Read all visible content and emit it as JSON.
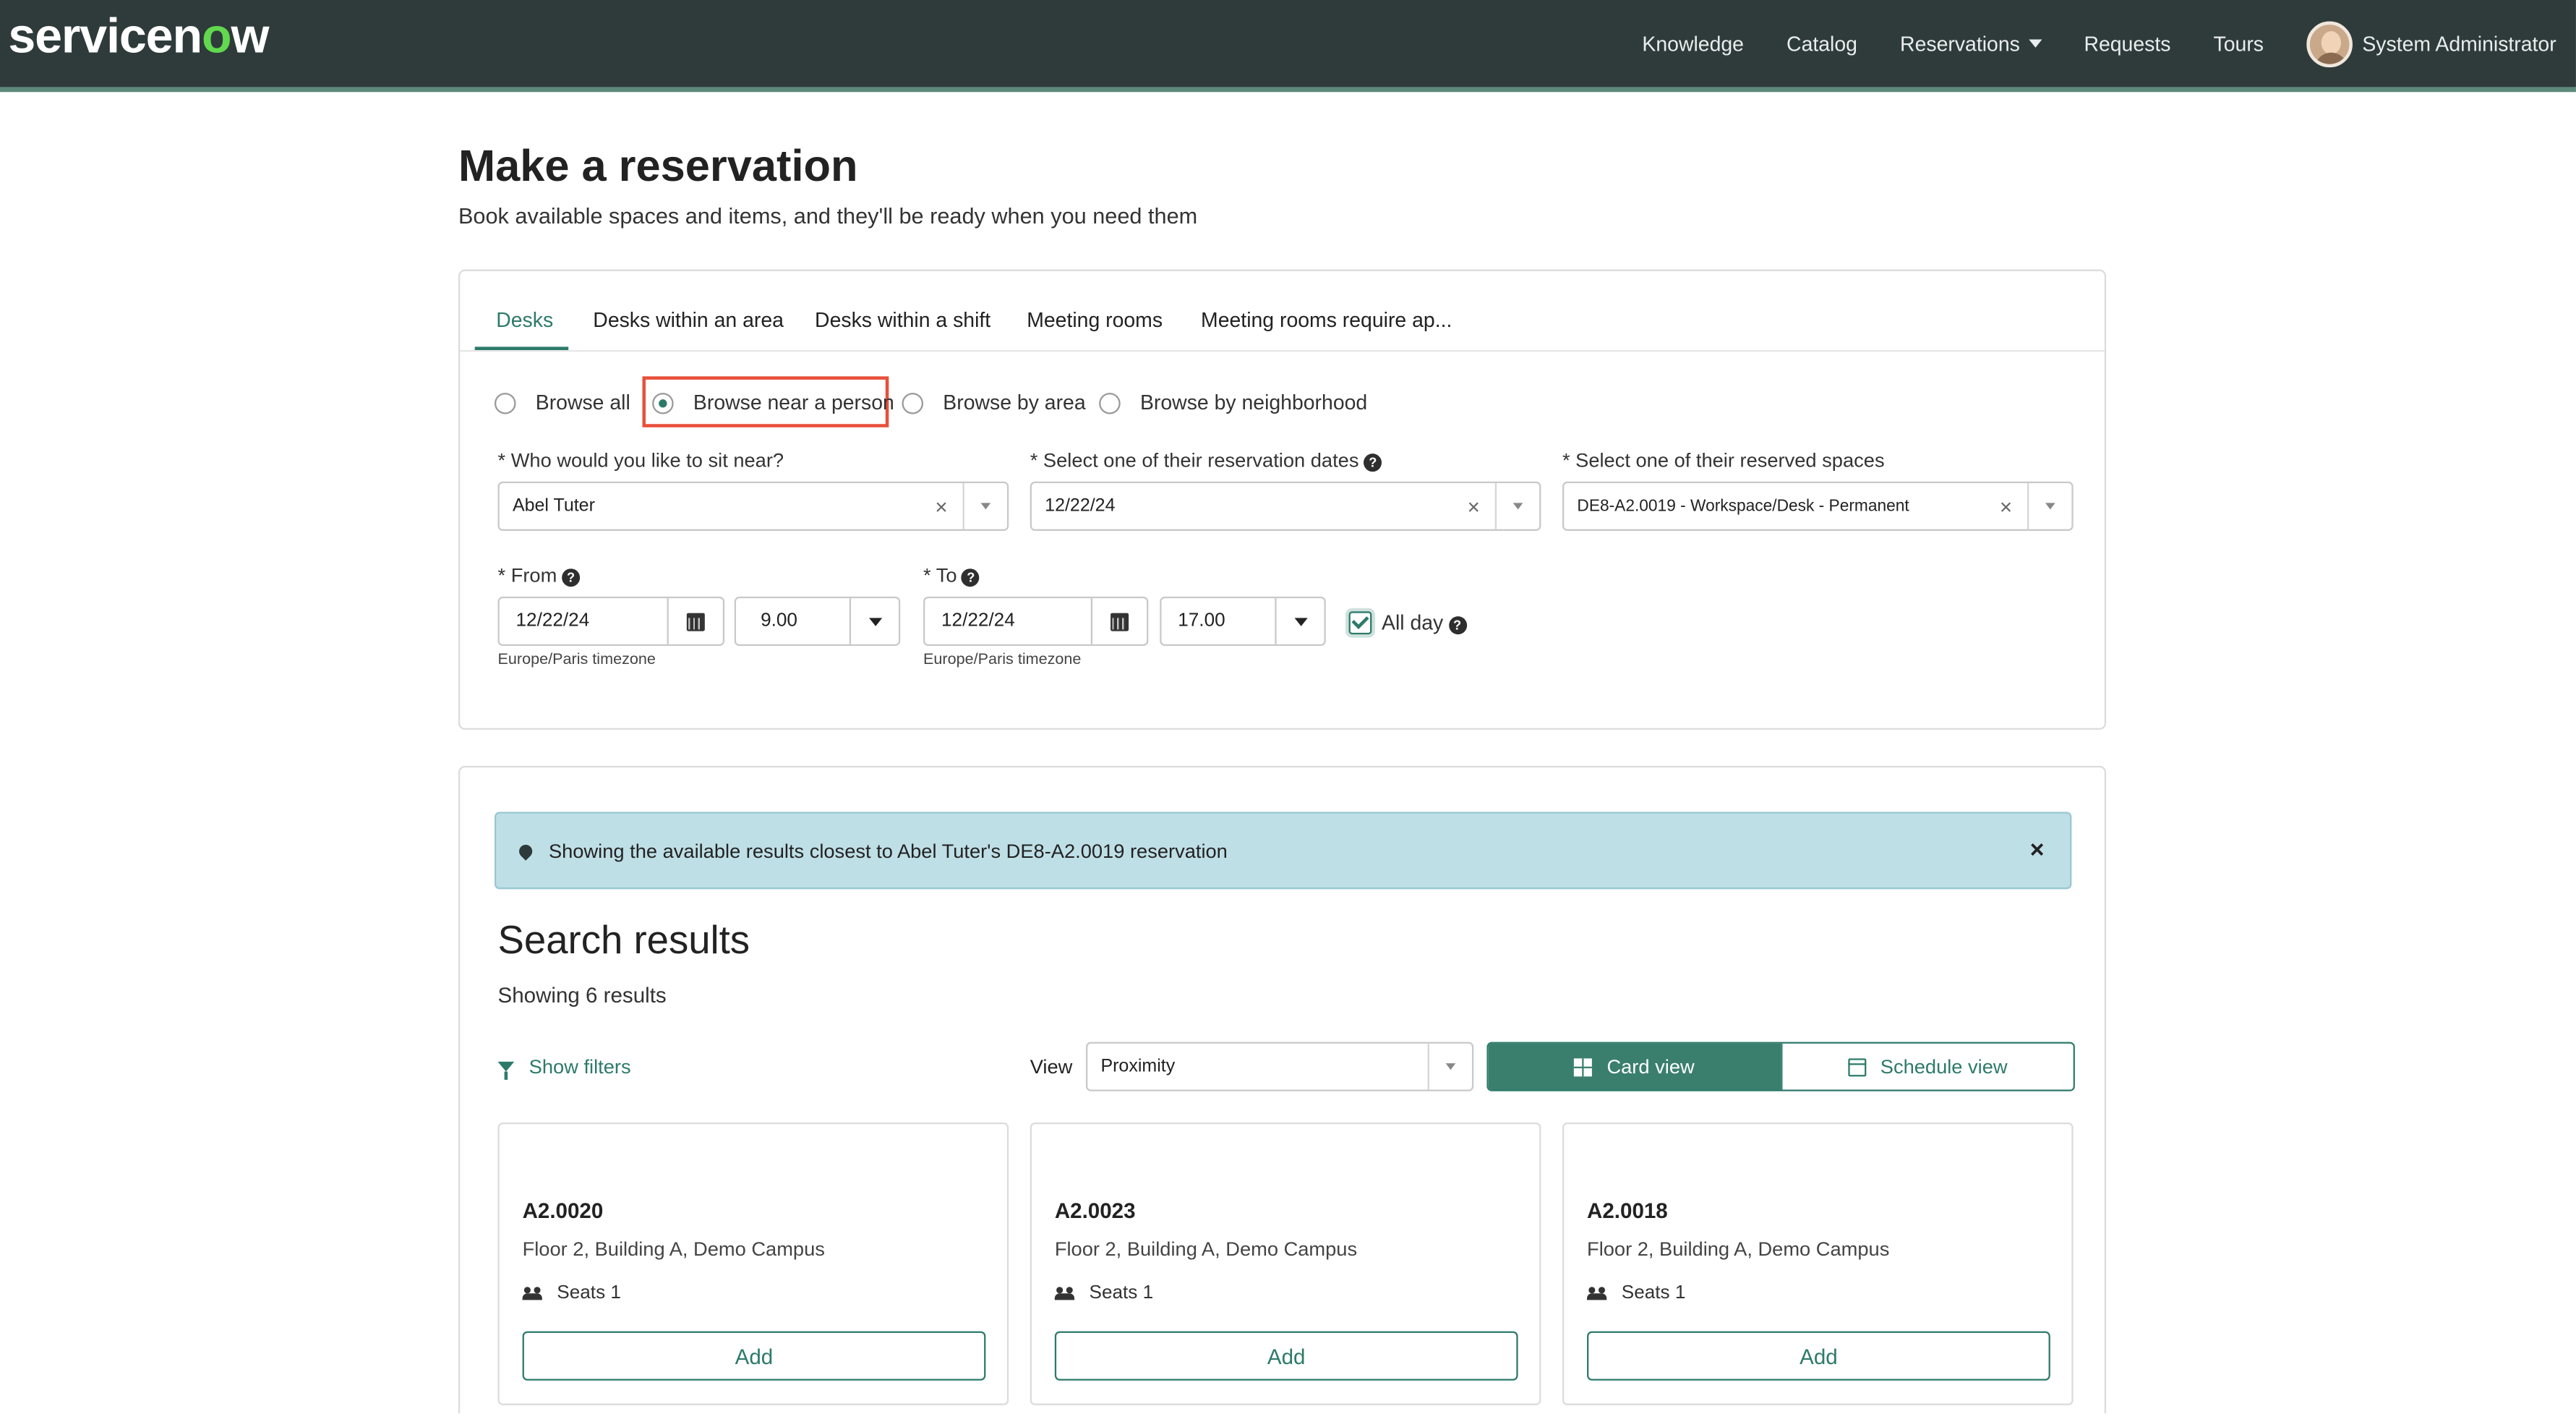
{
  "nav": {
    "logo_text_before": "servicen",
    "logo_o": "o",
    "logo_text_after": "w",
    "items": [
      "Knowledge",
      "Catalog",
      "Reservations",
      "Requests",
      "Tours"
    ],
    "user": "System Administrator"
  },
  "page": {
    "title": "Make a reservation",
    "subtitle": "Book available spaces and items, and they'll be ready when you need them"
  },
  "tabs": [
    "Desks",
    "Desks within an area",
    "Desks within a shift",
    "Meeting rooms",
    "Meeting rooms require ap..."
  ],
  "browse_options": [
    "Browse all",
    "Browse near a person",
    "Browse by area",
    "Browse by neighborhood"
  ],
  "browse_selected": "Browse near a person",
  "form": {
    "person_label": "* Who would you like to sit near?",
    "person_value": "Abel Tuter",
    "dates_label": "* Select one of their reservation dates",
    "dates_value": "12/22/24",
    "spaces_label": "* Select one of their reserved spaces",
    "spaces_value": "DE8-A2.0019 - Workspace/Desk - Permanent",
    "from_label": "* From",
    "from_date": "12/22/24",
    "from_time": "9.00",
    "from_tz": "Europe/Paris timezone",
    "to_label": "* To",
    "to_date": "12/22/24",
    "to_time": "17.00",
    "to_tz": "Europe/Paris timezone",
    "all_day_label": "All day",
    "all_day_checked": true,
    "help_glyph": "?",
    "clear_glyph": "×"
  },
  "results": {
    "alert": "Showing the available results closest to Abel Tuter's DE8-A2.0019 reservation",
    "alert_close": "×",
    "title": "Search results",
    "count": "Showing 6 results",
    "filters_label": "Show filters",
    "view_label": "View",
    "view_value": "Proximity",
    "card_view": "Card view",
    "schedule_view": "Schedule view",
    "cards": [
      {
        "name": "A2.0020",
        "location": "Floor 2, Building A, Demo Campus",
        "seats": "Seats 1",
        "button": "Add"
      },
      {
        "name": "A2.0023",
        "location": "Floor 2, Building A, Demo Campus",
        "seats": "Seats 1",
        "button": "Add"
      },
      {
        "name": "A2.0018",
        "location": "Floor 2, Building A, Demo Campus",
        "seats": "Seats 1",
        "button": "Add"
      }
    ]
  },
  "colors": {
    "topbar": "#2f3b3b",
    "accent": "#2d7a6a",
    "alert_bg": "#bfdfe6",
    "highlight": "#e8503a"
  }
}
